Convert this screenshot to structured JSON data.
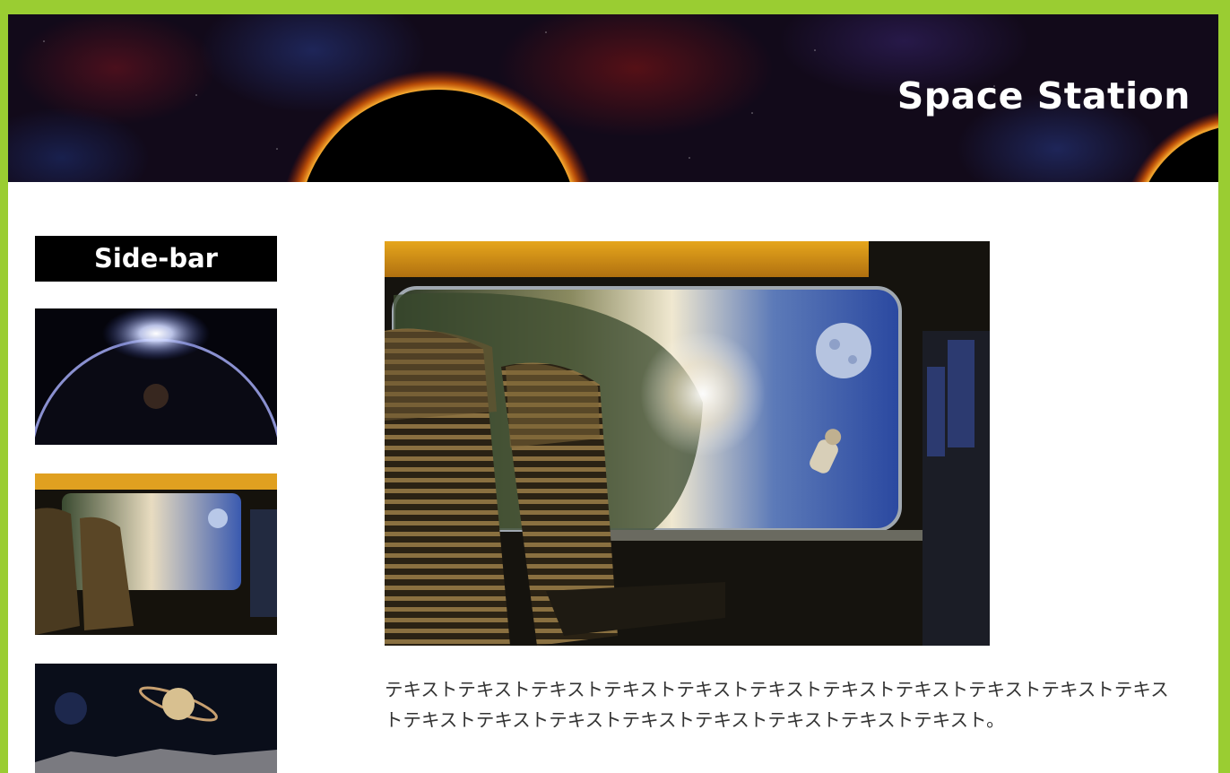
{
  "header": {
    "title": "Space Station",
    "background_image": "solar-eclipse-banner"
  },
  "sidebar": {
    "heading": "Side-bar",
    "thumbnails": [
      {
        "image": "planet-sunrise-thumbnail"
      },
      {
        "image": "train-window-space-thumbnail"
      },
      {
        "image": "saturn-moon-surface-thumbnail"
      }
    ]
  },
  "main": {
    "hero_image": "train-window-space-view",
    "body_text": "テキストテキストテキストテキストテキストテキストテキストテキストテキストテキストテキストテキストテキストテキストテキストテキストテキストテキストテキスト。"
  },
  "colors": {
    "page_border": "#9acd32",
    "content_background": "#ffffff",
    "sidebar_heading_background": "#000000",
    "title_text": "#ffffff",
    "body_text": "#333333"
  }
}
